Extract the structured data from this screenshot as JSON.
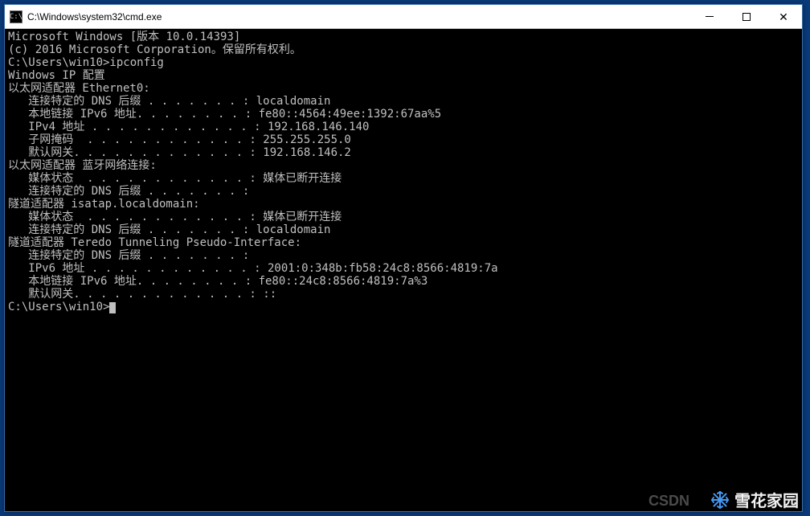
{
  "window": {
    "title": "C:\\Windows\\system32\\cmd.exe",
    "icon_label": "C:\\"
  },
  "terminal": {
    "lines": [
      "Microsoft Windows [版本 10.0.14393]",
      "(c) 2016 Microsoft Corporation。保留所有权利。",
      "",
      "C:\\Users\\win10>ipconfig",
      "",
      "Windows IP 配置",
      "",
      "",
      "以太网适配器 Ethernet0:",
      "",
      "   连接特定的 DNS 后缀 . . . . . . . : localdomain",
      "   本地链接 IPv6 地址. . . . . . . . : fe80::4564:49ee:1392:67aa%5",
      "   IPv4 地址 . . . . . . . . . . . . : 192.168.146.140",
      "   子网掩码  . . . . . . . . . . . . : 255.255.255.0",
      "   默认网关. . . . . . . . . . . . . : 192.168.146.2",
      "",
      "以太网适配器 蓝牙网络连接:",
      "",
      "   媒体状态  . . . . . . . . . . . . : 媒体已断开连接",
      "   连接特定的 DNS 后缀 . . . . . . . :",
      "",
      "隧道适配器 isatap.localdomain:",
      "",
      "   媒体状态  . . . . . . . . . . . . : 媒体已断开连接",
      "   连接特定的 DNS 后缀 . . . . . . . : localdomain",
      "",
      "隧道适配器 Teredo Tunneling Pseudo-Interface:",
      "",
      "   连接特定的 DNS 后缀 . . . . . . . :",
      "   IPv6 地址 . . . . . . . . . . . . : 2001:0:348b:fb58:24c8:8566:4819:7a",
      "   本地链接 IPv6 地址. . . . . . . . : fe80::24c8:8566:4819:7a%3",
      "   默认网关. . . . . . . . . . . . . : ::",
      "",
      "C:\\Users\\win10>"
    ],
    "prompt_cursor": true
  },
  "watermarks": {
    "csdn": "CSDN",
    "brand": "雪花家园"
  }
}
